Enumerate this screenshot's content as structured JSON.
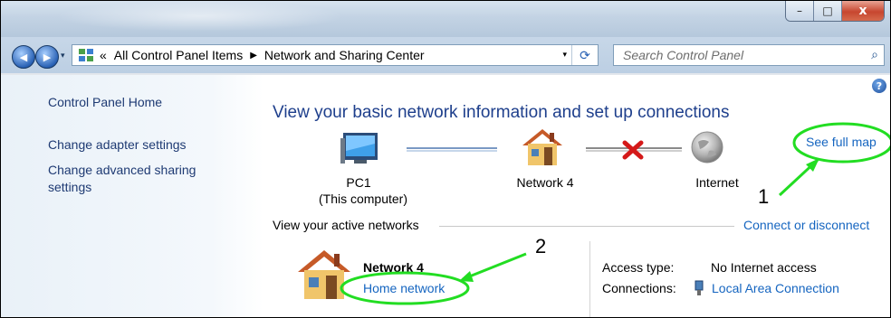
{
  "window": {
    "minimize_glyph": "–",
    "maximize_glyph": "□",
    "close_glyph": "x"
  },
  "nav": {
    "back_glyph": "◀",
    "forward_glyph": "▶",
    "history_glyph": "▾"
  },
  "address": {
    "overflow": "«",
    "crumbs": [
      "All Control Panel Items",
      "Network and Sharing Center"
    ],
    "separator": "▶",
    "dropdown_glyph": "▾",
    "refresh_glyph": "⟳"
  },
  "search": {
    "placeholder": "Search Control Panel",
    "icon_glyph": "⌕"
  },
  "sidebar": {
    "items": [
      {
        "label": "Control Panel Home"
      },
      {
        "label": "Change adapter settings"
      },
      {
        "label": "Change advanced sharing"
      },
      {
        "label": "settings"
      }
    ]
  },
  "main": {
    "help_glyph": "?",
    "heading": "View your basic network information and set up connections",
    "see_full_map": "See full map",
    "map": {
      "pc_name": "PC1",
      "pc_sub": "(This computer)",
      "network": "Network  4",
      "internet": "Internet"
    },
    "active_networks_label": "View your active networks",
    "connect_or_disconnect": "Connect or disconnect",
    "active_network": {
      "name": "Network  4",
      "type": "Home network",
      "access_type_label": "Access type:",
      "access_type_value": "No Internet access",
      "connections_label": "Connections:",
      "connections_value": "Local Area Connection"
    }
  },
  "callouts": {
    "one": "1",
    "two": "2",
    "color": "#22cc22"
  }
}
